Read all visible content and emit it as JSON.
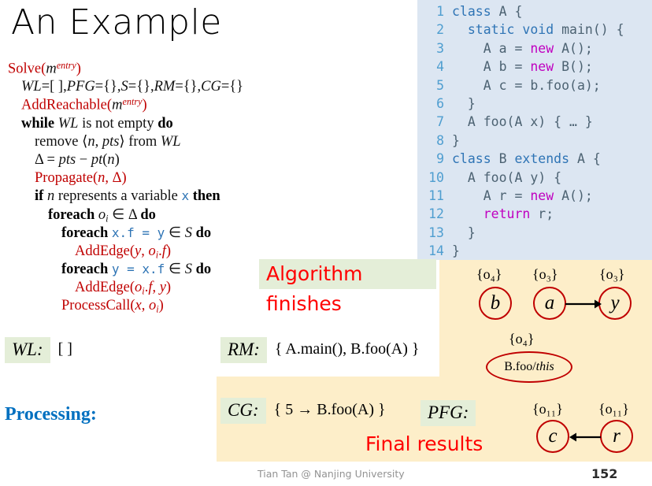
{
  "slide": {
    "title": "An Example",
    "footer_credit": "Tian Tan @ Nanjing University",
    "page_number": "152"
  },
  "colors": {
    "red": "#c00000",
    "code_bg": "#dce6f2",
    "result_bg": "#fdeec9",
    "highlight_bg": "#e4eed8",
    "banner_red": "#ff0000",
    "processing_blue": "#0070c0",
    "line_number_blue": "#4f9ed0"
  },
  "algorithm": {
    "lines": [
      {
        "indent": 0,
        "parts": [
          {
            "t": "Solve(",
            "c": "red"
          },
          {
            "t": "m",
            "c": "it"
          },
          {
            "t": "entry",
            "c": "sup"
          },
          {
            "t": ")",
            "c": "red"
          }
        ]
      },
      {
        "indent": 1,
        "parts": [
          {
            "t": "WL",
            "c": "it"
          },
          {
            "t": "=[ ],",
            "c": "plain"
          },
          {
            "t": "PFG",
            "c": "it"
          },
          {
            "t": "={},",
            "c": "plain"
          },
          {
            "t": "S",
            "c": "it"
          },
          {
            "t": "={},",
            "c": "plain"
          },
          {
            "t": "RM",
            "c": "it"
          },
          {
            "t": "={},",
            "c": "plain"
          },
          {
            "t": "CG",
            "c": "it"
          },
          {
            "t": "={}",
            "c": "plain"
          }
        ]
      },
      {
        "indent": 1,
        "parts": [
          {
            "t": "AddReachable(",
            "c": "red"
          },
          {
            "t": "m",
            "c": "it"
          },
          {
            "t": "entry",
            "c": "sup"
          },
          {
            "t": ")",
            "c": "red"
          }
        ]
      },
      {
        "indent": 1,
        "parts": [
          {
            "t": "while ",
            "c": "kw"
          },
          {
            "t": "WL",
            "c": "it"
          },
          {
            "t": " is not empty ",
            "c": "plain"
          },
          {
            "t": "do",
            "c": "kw"
          }
        ]
      },
      {
        "indent": 2,
        "parts": [
          {
            "t": "remove ⟨",
            "c": "plain"
          },
          {
            "t": "n",
            "c": "it"
          },
          {
            "t": ", ",
            "c": "plain"
          },
          {
            "t": "pts",
            "c": "it"
          },
          {
            "t": "⟩ from ",
            "c": "plain"
          },
          {
            "t": "WL",
            "c": "it"
          }
        ]
      },
      {
        "indent": 2,
        "parts": [
          {
            "t": "Δ = ",
            "c": "plain"
          },
          {
            "t": "pts",
            "c": "it"
          },
          {
            "t": " − ",
            "c": "plain"
          },
          {
            "t": "pt",
            "c": "it"
          },
          {
            "t": "(",
            "c": "plain"
          },
          {
            "t": "n",
            "c": "it"
          },
          {
            "t": ")",
            "c": "plain"
          }
        ]
      },
      {
        "indent": 2,
        "parts": [
          {
            "t": "Propagate(",
            "c": "red"
          },
          {
            "t": "n",
            "c": "redit"
          },
          {
            "t": ", Δ)",
            "c": "red"
          }
        ]
      },
      {
        "indent": 2,
        "parts": [
          {
            "t": "if ",
            "c": "kw"
          },
          {
            "t": "n",
            "c": "it"
          },
          {
            "t": " represents a variable ",
            "c": "plain"
          },
          {
            "t": "x",
            "c": "mono"
          },
          {
            "t": " then",
            "c": "kw"
          }
        ]
      },
      {
        "indent": 3,
        "parts": [
          {
            "t": "foreach ",
            "c": "kw"
          },
          {
            "t": "o",
            "c": "it"
          },
          {
            "t": "i",
            "c": "sub"
          },
          {
            "t": " ∈ Δ ",
            "c": "plain"
          },
          {
            "t": "do",
            "c": "kw"
          }
        ]
      },
      {
        "indent": 4,
        "parts": [
          {
            "t": "foreach ",
            "c": "kw"
          },
          {
            "t": "x.f = y",
            "c": "mono"
          },
          {
            "t": " ∈ ",
            "c": "plain"
          },
          {
            "t": "S",
            "c": "it"
          },
          {
            "t": " ",
            "c": "plain"
          },
          {
            "t": "do",
            "c": "kw"
          }
        ]
      },
      {
        "indent": 5,
        "parts": [
          {
            "t": "AddEdge(",
            "c": "red"
          },
          {
            "t": "y",
            "c": "redit"
          },
          {
            "t": ", ",
            "c": "red"
          },
          {
            "t": "o",
            "c": "redit"
          },
          {
            "t": "i",
            "c": "redsub"
          },
          {
            "t": ".",
            "c": "red"
          },
          {
            "t": "f",
            "c": "redit"
          },
          {
            "t": ")",
            "c": "red"
          }
        ]
      },
      {
        "indent": 4,
        "parts": [
          {
            "t": "foreach ",
            "c": "kw"
          },
          {
            "t": "y = x.f",
            "c": "mono"
          },
          {
            "t": " ∈ ",
            "c": "plain"
          },
          {
            "t": "S",
            "c": "it"
          },
          {
            "t": " ",
            "c": "plain"
          },
          {
            "t": "do",
            "c": "kw"
          }
        ]
      },
      {
        "indent": 5,
        "parts": [
          {
            "t": "AddEdge(",
            "c": "red"
          },
          {
            "t": "o",
            "c": "redit"
          },
          {
            "t": "i",
            "c": "redsub"
          },
          {
            "t": ".",
            "c": "red"
          },
          {
            "t": "f",
            "c": "redit"
          },
          {
            "t": ", ",
            "c": "red"
          },
          {
            "t": "y",
            "c": "redit"
          },
          {
            "t": ")",
            "c": "red"
          }
        ]
      },
      {
        "indent": 4,
        "parts": [
          {
            "t": "ProcessCall(",
            "c": "red"
          },
          {
            "t": "x",
            "c": "redit"
          },
          {
            "t": ", ",
            "c": "red"
          },
          {
            "t": "o",
            "c": "redit"
          },
          {
            "t": "i",
            "c": "redsub"
          },
          {
            "t": ")",
            "c": "red"
          }
        ]
      }
    ]
  },
  "code": {
    "lines": [
      {
        "n": "1",
        "tokens": [
          {
            "t": "class",
            "k": "kw"
          },
          {
            "t": " A {",
            "k": "type"
          }
        ]
      },
      {
        "n": "2",
        "tokens": [
          {
            "t": "  ",
            "k": "plain"
          },
          {
            "t": "static void",
            "k": "kw"
          },
          {
            "t": " main() {",
            "k": "type"
          }
        ]
      },
      {
        "n": "3",
        "tokens": [
          {
            "t": "    A a = ",
            "k": "type"
          },
          {
            "t": "new",
            "k": "new"
          },
          {
            "t": " A();",
            "k": "type"
          }
        ]
      },
      {
        "n": "4",
        "tokens": [
          {
            "t": "    A b = ",
            "k": "type"
          },
          {
            "t": "new",
            "k": "new"
          },
          {
            "t": " B();",
            "k": "type"
          }
        ]
      },
      {
        "n": "5",
        "tokens": [
          {
            "t": "    A c = b.foo(a);",
            "k": "type"
          }
        ]
      },
      {
        "n": "6",
        "tokens": [
          {
            "t": "  }",
            "k": "type"
          }
        ]
      },
      {
        "n": "7",
        "tokens": [
          {
            "t": "  A foo(A x) { … }",
            "k": "type"
          }
        ]
      },
      {
        "n": "8",
        "tokens": [
          {
            "t": "}",
            "k": "type"
          }
        ]
      },
      {
        "n": "9",
        "tokens": [
          {
            "t": "class",
            "k": "kw"
          },
          {
            "t": " B ",
            "k": "type"
          },
          {
            "t": "extends",
            "k": "kw"
          },
          {
            "t": " A {",
            "k": "type"
          }
        ]
      },
      {
        "n": "10",
        "tokens": [
          {
            "t": "  A foo(A y) {",
            "k": "type"
          }
        ]
      },
      {
        "n": "11",
        "tokens": [
          {
            "t": "    A r = ",
            "k": "type"
          },
          {
            "t": "new",
            "k": "new"
          },
          {
            "t": " A();",
            "k": "type"
          }
        ]
      },
      {
        "n": "12",
        "tokens": [
          {
            "t": "    ",
            "k": "type"
          },
          {
            "t": "return",
            "k": "new"
          },
          {
            "t": " r;",
            "k": "type"
          }
        ]
      },
      {
        "n": "13",
        "tokens": [
          {
            "t": "  }",
            "k": "type"
          }
        ]
      },
      {
        "n": "14",
        "tokens": [
          {
            "t": "}",
            "k": "type"
          }
        ]
      }
    ]
  },
  "banners": {
    "algorithm_finishes": "Algorithm finishes",
    "final_results": "Final results"
  },
  "sets": {
    "wl": {
      "tag": "WL:",
      "value": "[ ]"
    },
    "rm": {
      "tag": "RM:",
      "value": "{ A.main(), B.foo(A) }"
    },
    "cg": {
      "tag": "CG:",
      "value": "{ 5 → B.foo(A) }"
    },
    "pfg": {
      "tag": "PFG:",
      "value": ""
    }
  },
  "processing_label": "Processing:",
  "pfg_graph": {
    "nodes": [
      {
        "id": "b",
        "label": "b",
        "pts": "{o₄}"
      },
      {
        "id": "a",
        "label": "a",
        "pts": "{o₃}"
      },
      {
        "id": "y",
        "label": "y",
        "pts": "{o₃}"
      },
      {
        "id": "bfoothis",
        "label": "B.foo/this",
        "pts": "{o₄}"
      },
      {
        "id": "c",
        "label": "c",
        "pts": "{o₁₁}"
      },
      {
        "id": "r",
        "label": "r",
        "pts": "{o₁₁}"
      }
    ],
    "edges": [
      {
        "from": "a",
        "to": "y"
      },
      {
        "from": "r",
        "to": "c"
      }
    ]
  }
}
